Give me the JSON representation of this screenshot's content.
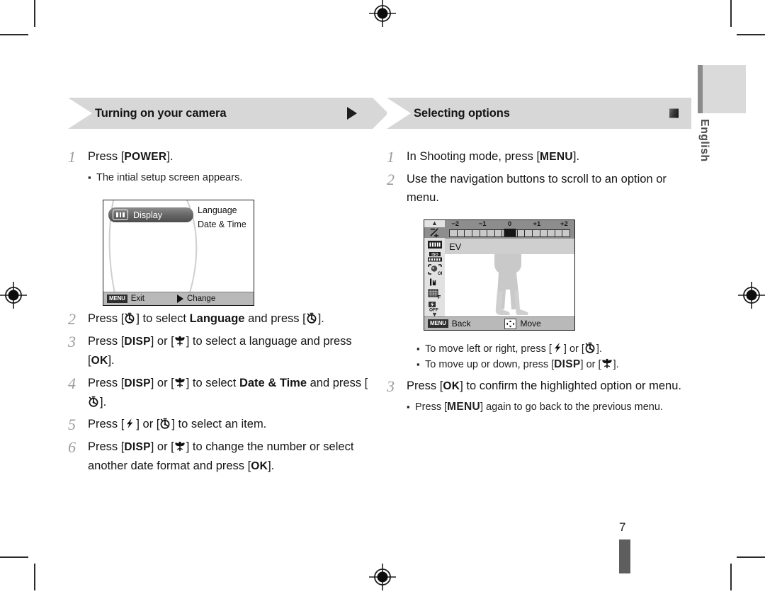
{
  "document": {
    "language_tab": "English",
    "page_number": "7"
  },
  "left_section": {
    "title": "Turning on your camera",
    "marker": "arrow-right-icon",
    "steps": [
      {
        "num": "1",
        "parts": [
          {
            "t": "text",
            "v": "Press ["
          },
          {
            "t": "key",
            "v": "POWER"
          },
          {
            "t": "text",
            "v": "]."
          }
        ],
        "notes": [
          "The intial setup screen appears."
        ]
      },
      {
        "num": "2",
        "parts": [
          {
            "t": "text",
            "v": "Press ["
          },
          {
            "t": "icon",
            "v": "self-timer-icon"
          },
          {
            "t": "text",
            "v": "] to select "
          },
          {
            "t": "bold",
            "v": "Language"
          },
          {
            "t": "text",
            "v": " and press ["
          },
          {
            "t": "icon",
            "v": "self-timer-icon"
          },
          {
            "t": "text",
            "v": "]."
          }
        ],
        "notes": []
      },
      {
        "num": "3",
        "parts": [
          {
            "t": "text",
            "v": "Press ["
          },
          {
            "t": "key",
            "v": "DISP"
          },
          {
            "t": "text",
            "v": "] or ["
          },
          {
            "t": "icon",
            "v": "macro-flower-icon"
          },
          {
            "t": "text",
            "v": "] to select a language and press ["
          },
          {
            "t": "key",
            "v": "OK"
          },
          {
            "t": "text",
            "v": "]."
          }
        ],
        "notes": []
      },
      {
        "num": "4",
        "parts": [
          {
            "t": "text",
            "v": "Press ["
          },
          {
            "t": "key",
            "v": "DISP"
          },
          {
            "t": "text",
            "v": "] or ["
          },
          {
            "t": "icon",
            "v": "macro-flower-icon"
          },
          {
            "t": "text",
            "v": "] to select "
          },
          {
            "t": "bold",
            "v": "Date & Time"
          },
          {
            "t": "text",
            "v": " and press ["
          },
          {
            "t": "icon",
            "v": "self-timer-icon"
          },
          {
            "t": "text",
            "v": "]."
          }
        ],
        "notes": []
      },
      {
        "num": "5",
        "parts": [
          {
            "t": "text",
            "v": "Press ["
          },
          {
            "t": "icon",
            "v": "flash-icon"
          },
          {
            "t": "text",
            "v": "] or ["
          },
          {
            "t": "icon",
            "v": "self-timer-icon"
          },
          {
            "t": "text",
            "v": "] to select an item."
          }
        ],
        "notes": []
      },
      {
        "num": "6",
        "parts": [
          {
            "t": "text",
            "v": "Press ["
          },
          {
            "t": "key",
            "v": "DISP"
          },
          {
            "t": "text",
            "v": "] or ["
          },
          {
            "t": "icon",
            "v": "macro-flower-icon"
          },
          {
            "t": "text",
            "v": "] to change the number or select another date format and press ["
          },
          {
            "t": "key",
            "v": "OK"
          },
          {
            "t": "text",
            "v": "]."
          }
        ],
        "notes": []
      }
    ]
  },
  "right_section": {
    "title": "Selecting options",
    "marker": "square-icon",
    "steps": [
      {
        "num": "1",
        "parts": [
          {
            "t": "text",
            "v": "In Shooting mode, press ["
          },
          {
            "t": "key",
            "v": "MENU"
          },
          {
            "t": "text",
            "v": "]."
          }
        ],
        "notes": []
      },
      {
        "num": "2",
        "parts": [
          {
            "t": "text",
            "v": "Use the navigation buttons to scroll to an option or menu."
          }
        ],
        "notes": []
      },
      {
        "num": "3",
        "parts": [
          {
            "t": "text",
            "v": "Press ["
          },
          {
            "t": "key",
            "v": "OK"
          },
          {
            "t": "text",
            "v": "] to confirm the highlighted option or menu."
          }
        ],
        "notes": []
      }
    ],
    "move_notes": [
      [
        {
          "t": "text",
          "v": "To move left or right, press ["
        },
        {
          "t": "icon",
          "v": "flash-icon"
        },
        {
          "t": "text",
          "v": "] or ["
        },
        {
          "t": "icon",
          "v": "self-timer-icon"
        },
        {
          "t": "text",
          "v": "]."
        }
      ],
      [
        {
          "t": "text",
          "v": "To move up or down, press ["
        },
        {
          "t": "key",
          "v": "DISP"
        },
        {
          "t": "text",
          "v": "] or ["
        },
        {
          "t": "icon",
          "v": "macro-flower-icon"
        },
        {
          "t": "text",
          "v": "]."
        }
      ]
    ],
    "step3_notes": [
      [
        {
          "t": "text",
          "v": "Press ["
        },
        {
          "t": "key",
          "v": "MENU"
        },
        {
          "t": "text",
          "v": "] again to go back to the previous menu."
        }
      ]
    ]
  },
  "setup_screen": {
    "selected_item": "Display",
    "selected_icon": "display-screen-icon",
    "options": [
      "Language",
      "Date & Time"
    ],
    "bottom_bar": {
      "menu_badge": "MENU",
      "left_label": "Exit",
      "right_icon": "arrow-right-icon",
      "right_label": "Change"
    }
  },
  "ev_screen": {
    "selected_option": "EV",
    "selected_icon": "ev-exposure-icon",
    "side_icons": [
      "scroll-up-icon",
      "ev-exposure-icon",
      "white-balance-awb-icon",
      "iso-icon",
      "face-detection-off-icon",
      "image-size-m-icon",
      "quality-f-icon",
      "flash-off-icon",
      "scroll-down-icon"
    ],
    "scale": {
      "labels": [
        "-2",
        "-1",
        "0",
        "+1",
        "+2"
      ],
      "positions_pct": [
        8,
        29,
        50,
        71,
        92
      ],
      "ticks": 16,
      "marker_pct": 50,
      "value": "0"
    },
    "bottom_bar": {
      "menu_badge": "MENU",
      "left_label": "Back",
      "right_icon": "4-way-navigation-icon",
      "right_label": "Move"
    }
  },
  "colors": {
    "banner_gray": "#d7d7d7",
    "step_number_gray": "#9b9b9b",
    "screen_bar_gray": "#b9b9b9",
    "ev_scale_gray": "#8d8d8d",
    "tab_gray": "#dadada",
    "page_bar_gray": "#5e5e5e"
  }
}
